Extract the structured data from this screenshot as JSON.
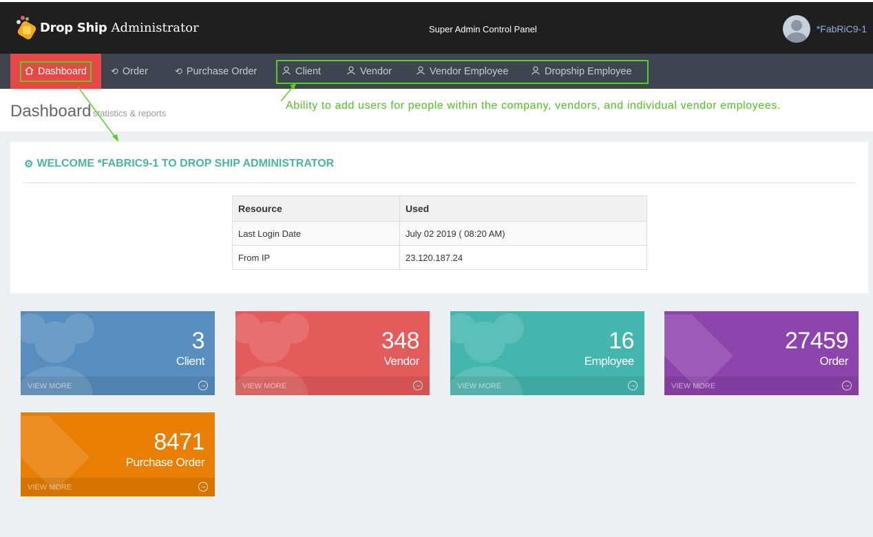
{
  "header": {
    "brand_bold": "Drop Ship",
    "brand_light": "Administrator",
    "panel_title": "Super Admin Control Panel",
    "username": "*FabRiC9-1"
  },
  "nav": {
    "items": [
      {
        "label": "Dashboard",
        "icon": "home-icon",
        "active": true
      },
      {
        "label": "Order",
        "icon": "history-icon"
      },
      {
        "label": "Purchase Order",
        "icon": "history-icon"
      },
      {
        "label": "Client",
        "icon": "user-icon"
      },
      {
        "label": "Vendor",
        "icon": "user-icon"
      },
      {
        "label": "Vendor Employee",
        "icon": "user-icon"
      },
      {
        "label": "Dropship Employee",
        "icon": "user-icon"
      }
    ]
  },
  "page": {
    "title": "Dashboard",
    "subtitle": "statistics & reports",
    "annotation": "Ability to add users for people within the company, vendors, and individual vendor employees."
  },
  "welcome": {
    "title": "WELCOME *FABRIC9-1 TO DROP SHIP ADMINISTRATOR",
    "table": {
      "headers": [
        "Resource",
        "Used"
      ],
      "rows": [
        [
          "Last Login Date",
          "July 02 2019 ( 08:20 AM)"
        ],
        [
          "From IP",
          "23.120.187.24"
        ]
      ]
    }
  },
  "tiles": [
    {
      "value": "3",
      "label": "Client",
      "link": "VIEW MORE",
      "color": "#578ebe"
    },
    {
      "value": "348",
      "label": "Vendor",
      "link": "VIEW MORE",
      "color": "#e35b5a"
    },
    {
      "value": "16",
      "label": "Employee",
      "link": "VIEW MORE",
      "color": "#44b6ae"
    },
    {
      "value": "27459",
      "label": "Order",
      "link": "VIEW MORE",
      "color": "#8e44ad"
    },
    {
      "value": "8471",
      "label": "Purchase Order",
      "link": "VIEW MORE",
      "color": "#e87e04"
    }
  ],
  "colors": {
    "annotation_green": "#58d022",
    "active_nav": "#e54845",
    "welcome_title": "#4ab3a6"
  }
}
